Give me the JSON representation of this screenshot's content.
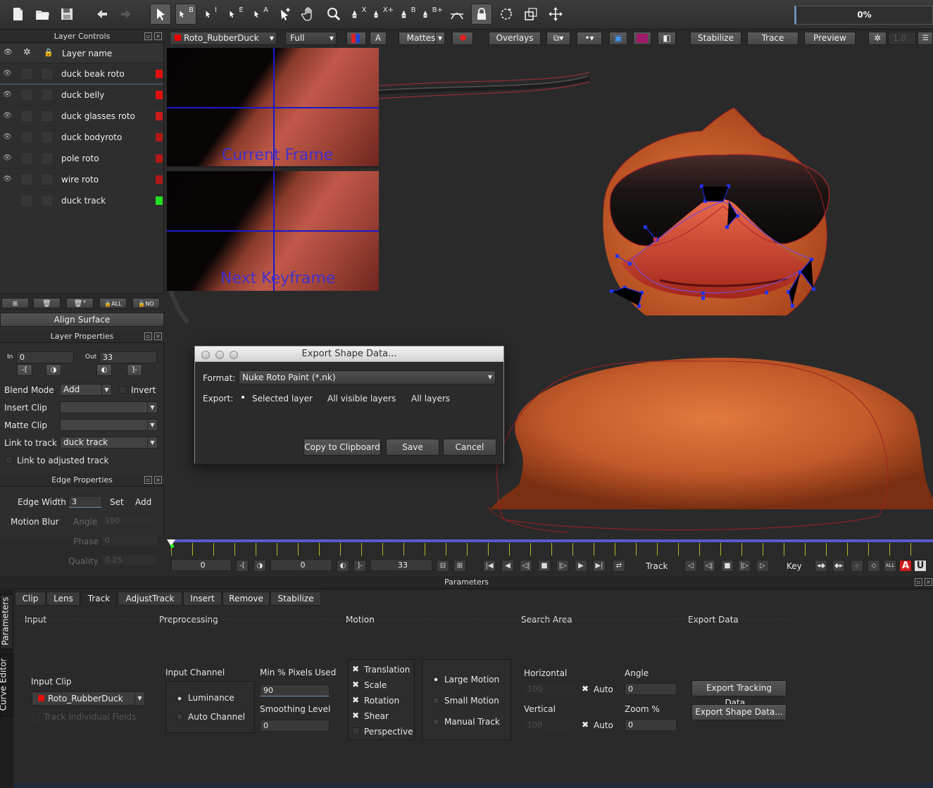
{
  "toolbar": {
    "icons": [
      "new-file-icon",
      "open-folder-icon",
      "save-icon",
      "undo-icon",
      "redo-icon",
      "select-arrow-icon",
      "select-b-icon",
      "select-i-icon",
      "select-e-icon",
      "select-a-icon",
      "add-point-icon",
      "hand-pan-icon",
      "zoom-icon",
      "pen-x-icon",
      "pen-xplus-icon",
      "pen-b-icon",
      "pen-bplus-icon",
      "tangent-icon",
      "lock-icon",
      "rotate-icon",
      "scale-icon",
      "move-icon"
    ],
    "letters": {
      "b": "B",
      "i": "I",
      "e": "E",
      "a": "A",
      "x": "X",
      "xp": "X+",
      "pb": "B",
      "pbp": "B+"
    },
    "progress": "0%"
  },
  "viewer_bar": {
    "clip": "Roto_RubberDuck",
    "resolution": "Full",
    "channel": "A",
    "mattes": "Mattes",
    "overlays": "Overlays",
    "stabilize": "Stabilize",
    "trace": "Trace",
    "preview": "Preview",
    "value": "1.0"
  },
  "layer_controls": {
    "title": "Layer Controls",
    "header": "Layer name",
    "layers": [
      {
        "name": "duck beak roto",
        "color": "#e01010",
        "visible": true
      },
      {
        "name": "duck belly",
        "color": "#e01010",
        "visible": true
      },
      {
        "name": "duck glasses roto",
        "color": "#cc1a1a",
        "visible": true
      },
      {
        "name": "duck bodyroto",
        "color": "#b01818",
        "visible": true
      },
      {
        "name": "pole roto",
        "color": "#b01818",
        "visible": true
      },
      {
        "name": "wire roto",
        "color": "#b01818",
        "visible": true
      },
      {
        "name": "duck track",
        "color": "#22dd22",
        "visible": false
      }
    ],
    "align_surface": "Align Surface"
  },
  "layer_properties": {
    "title": "Layer Properties",
    "in_label": "In",
    "in_value": "0",
    "out_label": "Out",
    "out_value": "33",
    "blend_mode_label": "Blend Mode",
    "blend_mode": "Add",
    "invert": "Invert",
    "insert_clip": "Insert Clip",
    "matte_clip": "Matte Clip",
    "link_to_track": "Link to track",
    "link_track_value": "duck track",
    "link_adjusted": "Link to adjusted track"
  },
  "edge_properties": {
    "title": "Edge Properties",
    "edge_width_label": "Edge Width",
    "edge_width": "3",
    "set": "Set",
    "add": "Add",
    "motion_blur": "Motion Blur",
    "angle_label": "Angle",
    "angle": "180",
    "phase_label": "Phase",
    "phase": "0",
    "quality_label": "Quality",
    "quality": "0.25"
  },
  "magnifier": {
    "current": "Current Frame",
    "next": "Next Keyframe"
  },
  "dialog": {
    "title": "Export Shape Data...",
    "format_label": "Format:",
    "format_value": "Nuke Roto Paint (*.nk)",
    "export_label": "Export:",
    "options": [
      "Selected layer",
      "All visible layers",
      "All layers"
    ],
    "selected": 0,
    "copy": "Copy to Clipboard",
    "save": "Save",
    "cancel": "Cancel"
  },
  "timeline": {
    "start": "0",
    "current": "0",
    "end": "33",
    "track_label": "Track",
    "key_label": "Key",
    "parameters_title": "Parameters"
  },
  "side_tabs": [
    "Parameters",
    "Curve Editor"
  ],
  "tabs": [
    "Clip",
    "Lens",
    "Track",
    "AdjustTrack",
    "Insert",
    "Remove",
    "Stabilize"
  ],
  "active_tab": "Track",
  "sections": {
    "input": "Input",
    "preprocessing": "Preprocessing",
    "motion": "Motion",
    "search_area": "Search Area",
    "export_data": "Export Data"
  },
  "track": {
    "input_clip_label": "Input Clip",
    "input_clip": "Roto_RubberDuck",
    "track_fields": "Track Individual Fields",
    "input_channel_label": "Input Channel",
    "luminance": "Luminance",
    "auto_channel": "Auto Channel",
    "min_pixels_label": "Min % Pixels Used",
    "min_pixels": "90",
    "smoothing_label": "Smoothing Level",
    "smoothing": "0",
    "motion_types": [
      "Translation",
      "Scale",
      "Rotation",
      "Shear",
      "Perspective"
    ],
    "motion_modes": [
      "Large Motion",
      "Small Motion",
      "Manual Track"
    ],
    "horizontal_label": "Horizontal",
    "horizontal": "100",
    "vertical_label": "Vertical",
    "vertical": "100",
    "auto": "Auto",
    "angle_label": "Angle",
    "angle": "0",
    "zoom_label": "Zoom %",
    "zoom": "0",
    "export_tracking": "Export Tracking Data...",
    "export_shape": "Export Shape Data..."
  }
}
